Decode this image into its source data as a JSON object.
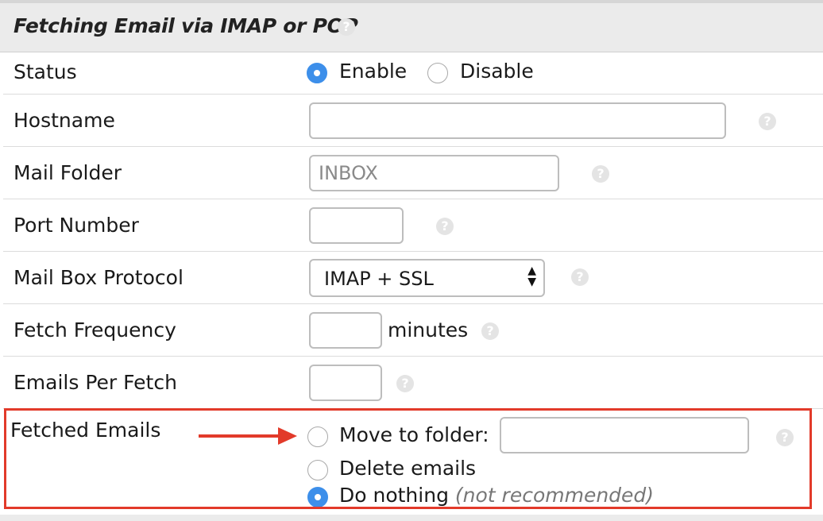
{
  "section": {
    "title": "Fetching Email via IMAP or POP"
  },
  "fields": {
    "status": {
      "label": "Status",
      "options": [
        "Enable",
        "Disable"
      ],
      "selected": "Enable"
    },
    "hostname": {
      "label": "Hostname",
      "value": ""
    },
    "mail_folder": {
      "label": "Mail Folder",
      "placeholder": "INBOX"
    },
    "port_number": {
      "label": "Port Number",
      "value": ""
    },
    "mail_box_protocol": {
      "label": "Mail Box Protocol",
      "value": "IMAP + SSL"
    },
    "fetch_frequency": {
      "label": "Fetch Frequency",
      "value": "",
      "suffix": "minutes"
    },
    "emails_per_fetch": {
      "label": "Emails Per Fetch",
      "value": ""
    },
    "fetched_emails": {
      "label": "Fetched Emails",
      "options": {
        "move": "Move to folder:",
        "delete": "Delete emails",
        "nothing": "Do nothing",
        "nothing_note": "(not recommended)"
      },
      "selected": "Do nothing",
      "move_folder_value": ""
    }
  },
  "annotation": {
    "highlight_color": "#e23a2a"
  },
  "colors": {
    "accent": "#3d8fea"
  }
}
